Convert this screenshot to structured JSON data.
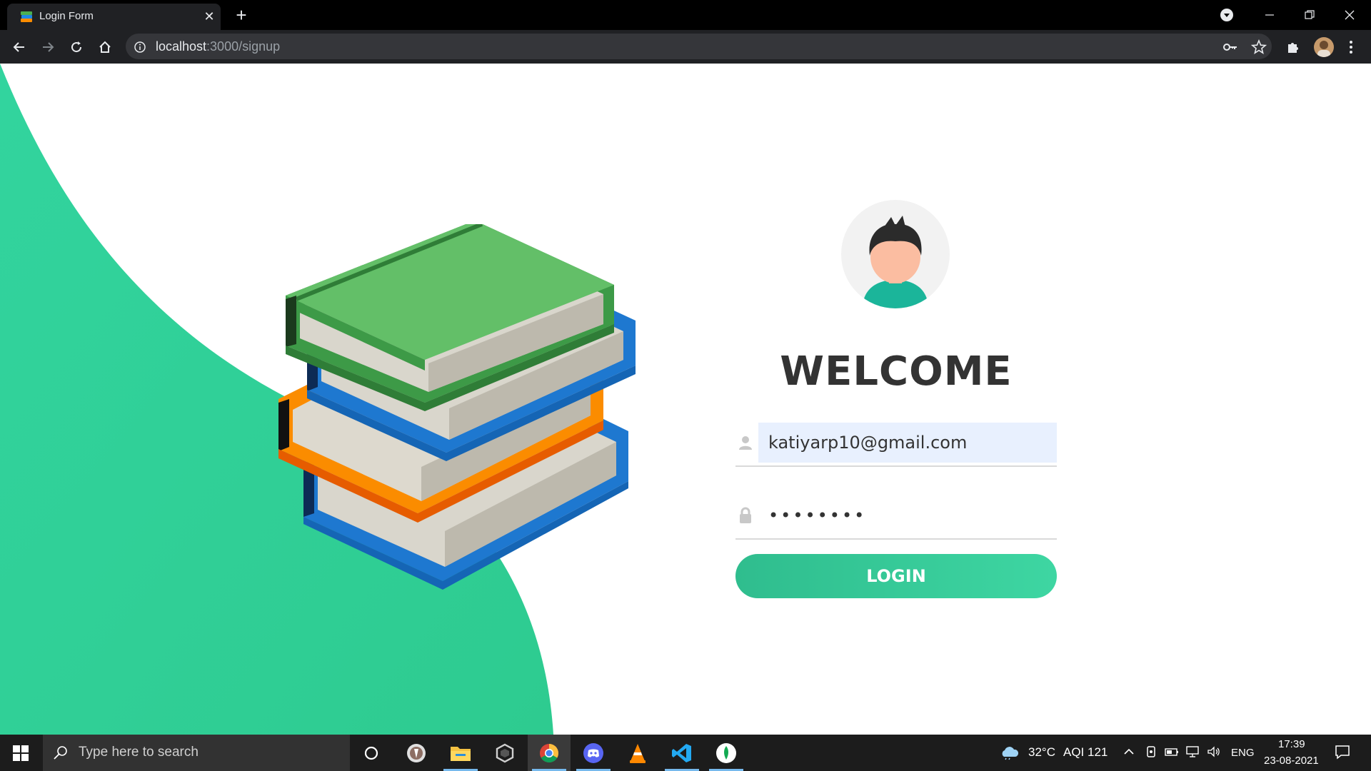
{
  "browser": {
    "tab_title": "Login Form",
    "url_host": "localhost",
    "url_path": ":3000/signup"
  },
  "page": {
    "colors": {
      "accent": "#2ecf95",
      "text": "#333333",
      "field_autofill_bg": "#e8f0fe"
    },
    "heading": "WELCOME",
    "email_value": "katiyarp10@gmail.com",
    "password_value": "••••••••",
    "login_label": "LOGIN"
  },
  "taskbar": {
    "search_placeholder": "Type here to search",
    "weather": "32°C",
    "aqi": "AQI 121",
    "language": "ENG",
    "time": "17:39",
    "date": "23-08-2021",
    "pinned_apps": [
      "cortana-icon",
      "inkscape-icon",
      "file-explorer-icon",
      "unity-icon",
      "chrome-icon",
      "discord-icon",
      "vlc-icon",
      "vscode-icon",
      "mongodb-compass-icon"
    ]
  }
}
